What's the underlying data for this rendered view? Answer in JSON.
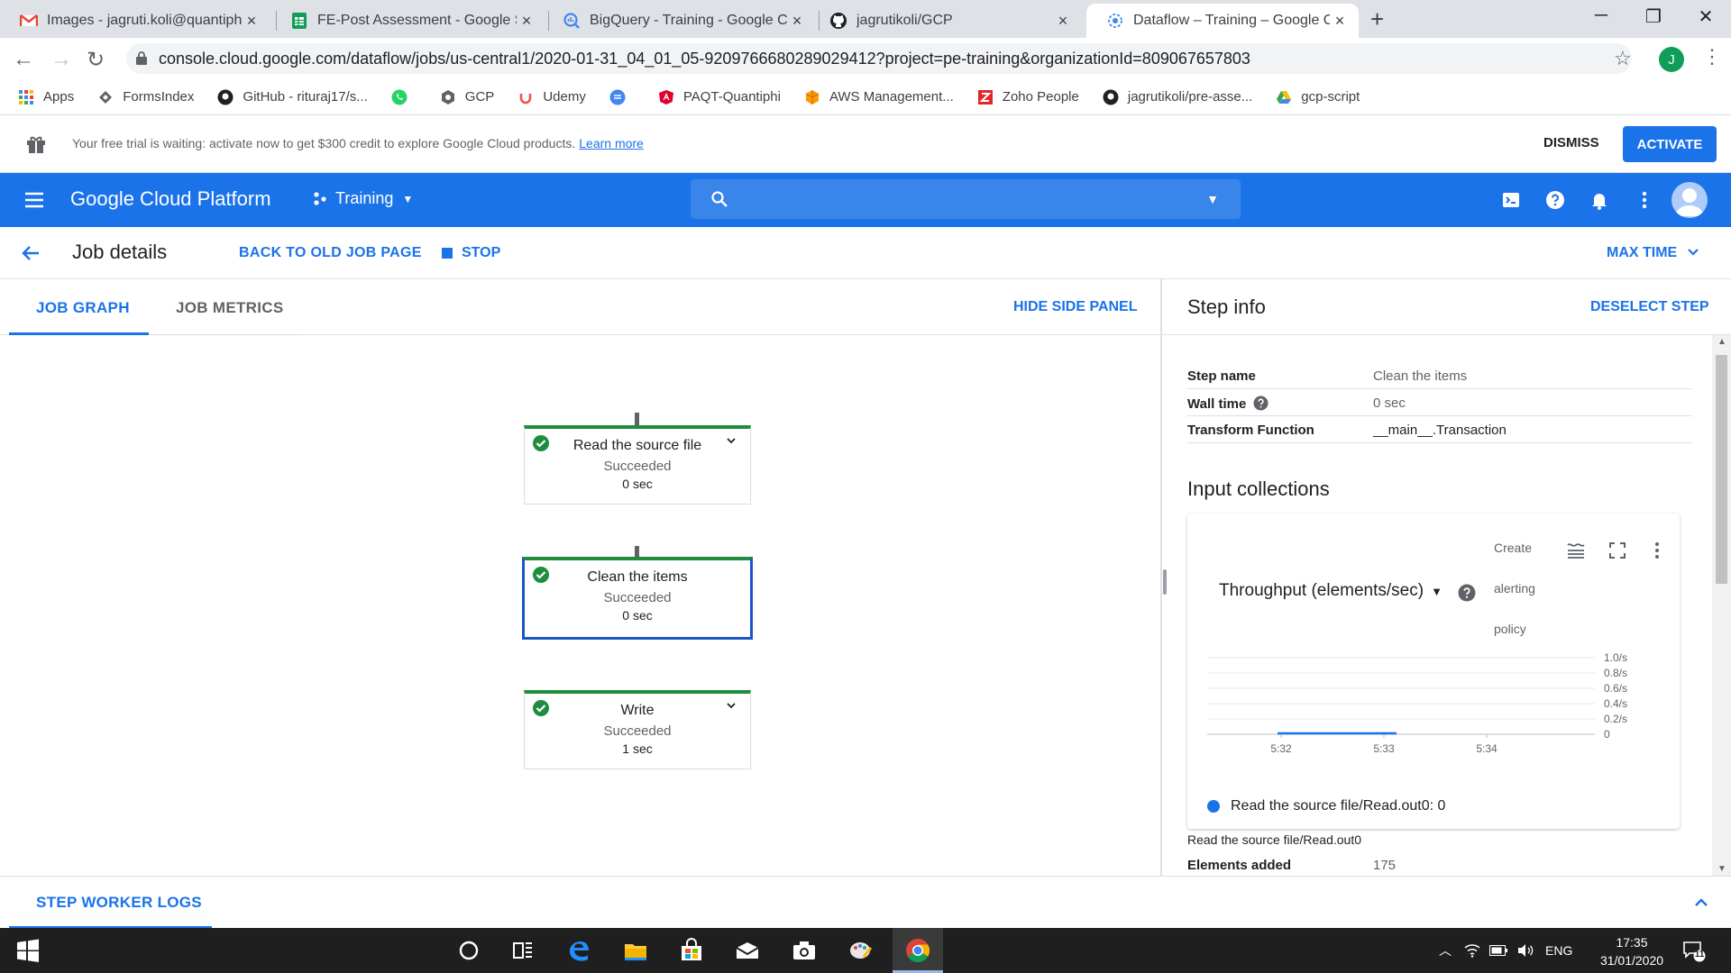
{
  "browser": {
    "tabs": [
      {
        "title": "Images - jagruti.koli@quantiphi.c",
        "icon": "gmail-icon"
      },
      {
        "title": "FE-Post Assessment - Google She",
        "icon": "sheets-icon"
      },
      {
        "title": "BigQuery - Training - Google Clo",
        "icon": "bigquery-icon"
      },
      {
        "title": "jagrutikoli/GCP",
        "icon": "github-icon"
      },
      {
        "title": "Dataflow – Training – Google Clo",
        "icon": "dataflow-icon"
      }
    ],
    "url": "console.cloud.google.com/dataflow/jobs/us-central1/2020-01-31_04_01_05-9209766680289029412?project=pe-training&organizationId=809067657803",
    "profile_initial": "J",
    "bookmarks": [
      {
        "label": "Apps",
        "color": "#4285f4"
      },
      {
        "label": "FormsIndex",
        "color": "#5f6368"
      },
      {
        "label": "GitHub - rituraj17/s...",
        "color": "#202124"
      },
      {
        "label": "",
        "color": "#25d366"
      },
      {
        "label": "GCP",
        "color": "#5f6368"
      },
      {
        "label": "Udemy",
        "color": "#ec5252"
      },
      {
        "label": "",
        "color": "#4285f4"
      },
      {
        "label": "PAQT-Quantiphi",
        "color": "#dd0031"
      },
      {
        "label": "AWS Management...",
        "color": "#ff9900"
      },
      {
        "label": "Zoho People",
        "color": "#e42527"
      },
      {
        "label": "jagrutikoli/pre-asse...",
        "color": "#202124"
      },
      {
        "label": "gcp-script",
        "color": "#fbbc04"
      }
    ]
  },
  "banner": {
    "message": "Your free trial is waiting: activate now to get $300 credit to explore Google Cloud products.",
    "learn_more": "Learn more",
    "dismiss": "DISMISS",
    "activate": "ACTIVATE"
  },
  "header": {
    "title": "Google Cloud Platform",
    "project": "Training"
  },
  "jobbar": {
    "title": "Job details",
    "back_old": "BACK TO OLD JOB PAGE",
    "stop": "STOP",
    "max_time": "MAX TIME"
  },
  "tabs": {
    "graph": "JOB GRAPH",
    "metrics": "JOB METRICS",
    "hide_panel": "HIDE SIDE PANEL"
  },
  "graph": {
    "nodes": [
      {
        "name": "Read the source file",
        "status": "Succeeded",
        "time": "0 sec"
      },
      {
        "name": "Clean the items",
        "status": "Succeeded",
        "time": "0 sec"
      },
      {
        "name": "Write",
        "status": "Succeeded",
        "time": "1 sec"
      }
    ]
  },
  "panel": {
    "title": "Step info",
    "deselect": "DESELECT STEP",
    "step_name_label": "Step name",
    "step_name": "Clean the items",
    "wall_time_label": "Wall time",
    "wall_time": "0 sec",
    "transform_label": "Transform Function",
    "transform": "__main__.Transaction",
    "input_collections": "Input collections",
    "create": "Create",
    "alerting": "alerting",
    "policy": "policy",
    "metric": "Throughput (elements/sec)",
    "legend": "Read the source file/Read.out0: 0",
    "collection": "Read the source file/Read.out0",
    "elements_added_label": "Elements added",
    "elements_added": "175"
  },
  "chart_data": {
    "type": "line",
    "x": [
      "5:32",
      "5:33",
      "5:34"
    ],
    "series": [
      {
        "name": "Read the source file/Read.out0",
        "values": [
          0,
          0,
          0
        ]
      }
    ],
    "y_ticks": [
      "1.0/s",
      "0.8/s",
      "0.6/s",
      "0.4/s",
      "0.2/s",
      "0"
    ],
    "ylim": [
      0,
      1.0
    ],
    "color": "#1a73e8"
  },
  "logs": {
    "tab": "STEP WORKER LOGS"
  },
  "taskbar": {
    "lang": "ENG",
    "time": "17:35",
    "date": "31/01/2020",
    "notifications": "11"
  }
}
